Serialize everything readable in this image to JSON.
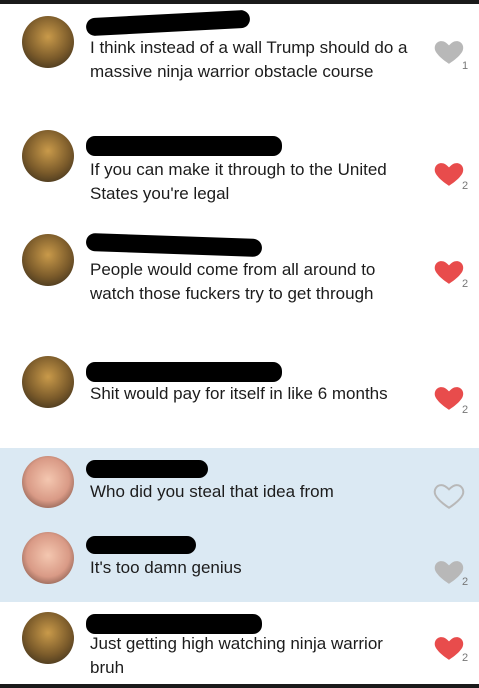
{
  "comments": [
    {
      "text": "I think instead of a wall Trump should do a massive ninja warrior obstacle course",
      "likes": "1",
      "liked": false,
      "avatar": "trump-avatar",
      "highlighted": false
    },
    {
      "text": "If you can make it through to the United States you're legal",
      "likes": "2",
      "liked": true,
      "avatar": "trump-avatar",
      "highlighted": false
    },
    {
      "text": "People would come from all around to watch those fuckers try to get through",
      "likes": "2",
      "liked": true,
      "avatar": "trump-avatar",
      "highlighted": false
    },
    {
      "text": "Shit would pay for itself in like 6 months",
      "likes": "2",
      "liked": true,
      "avatar": "trump-avatar",
      "highlighted": false
    },
    {
      "text": "Who did you steal that idea from",
      "likes": "",
      "liked": false,
      "avatar": "baby-avatar",
      "highlighted": true
    },
    {
      "text": "It's too damn genius",
      "likes": "2",
      "liked": false,
      "avatar": "baby-avatar",
      "highlighted": true
    },
    {
      "text": "Just getting high watching ninja warrior bruh",
      "likes": "2",
      "liked": true,
      "avatar": "trump-avatar",
      "highlighted": false
    }
  ],
  "colors": {
    "liked": "#e84c4c",
    "unliked": "#b8b8b8",
    "highlight": "#dbe9f3"
  },
  "icons": {
    "like": "heart-icon"
  }
}
